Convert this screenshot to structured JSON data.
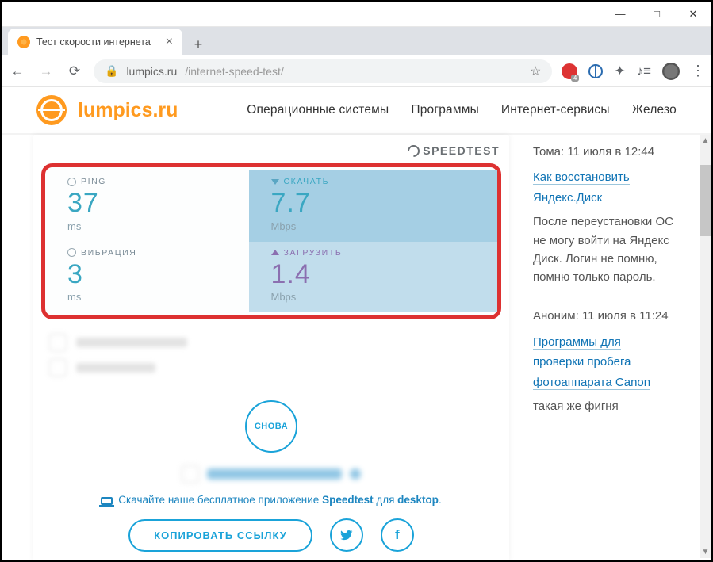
{
  "window": {
    "min": "—",
    "max": "□",
    "close": "✕"
  },
  "browser": {
    "tab_title": "Тест скорости интернета",
    "url_host": "lumpics.ru",
    "url_path": "/internet-speed-test/"
  },
  "site": {
    "logo": "lumpics.ru",
    "nav": [
      "Операционные системы",
      "Программы",
      "Интернет-сервисы",
      "Железо"
    ]
  },
  "speedtest": {
    "brand": "SPEEDTEST",
    "ping_label": "PING",
    "ping_value": "37",
    "ping_unit": "ms",
    "jitter_label": "ВИБРАЦИЯ",
    "jitter_value": "3",
    "jitter_unit": "ms",
    "download_label": "СКАЧАТЬ",
    "download_value": "7.7",
    "download_unit": "Mbps",
    "upload_label": "ЗАГРУЗИТЬ",
    "upload_value": "1.4",
    "upload_unit": "Mbps",
    "again": "СНОВА",
    "dl_line_pre": "Скачайте наше бесплатное приложение ",
    "dl_line_b1": "Speedtest",
    "dl_line_mid": " для ",
    "dl_line_b2": "desktop",
    "dl_line_end": ".",
    "copy": "КОПИРОВАТЬ ССЫЛКУ"
  },
  "sidebar": {
    "c1_meta": "Тома: 11 июля в 12:44",
    "c1_link": "Как восстановить Яндекс.Диск",
    "c1_body": "После переустановки ОС не могу войти на Яндекс Диск. Логин не помню, помню только пароль.",
    "c2_meta": "Аноним: 11 июля в 11:24",
    "c2_link": "Программы для проверки пробега фотоаппарата Canon",
    "c2_body": "такая же фигня"
  }
}
